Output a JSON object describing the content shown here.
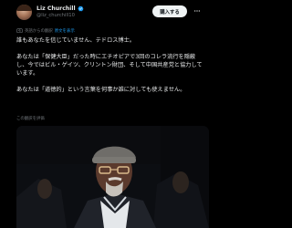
{
  "author": {
    "display_name": "Liz Churchill",
    "verified": true,
    "handle": "@liz_churchill10"
  },
  "header": {
    "follow_label": "購入する",
    "more_icon": "more-horizontal-icon"
  },
  "translation": {
    "prefix": "英語からの翻訳",
    "link": "原文を表示"
  },
  "post": {
    "paragraphs": [
      "誰もあなたを信じていません、テドロス博士。",
      "あなたは「保健大臣」だった時にエチオピアで3回のコレラ流行を隠蔽し、今ではビル・ゲイツ、クリントン財団、そして中国共産党と協力しています。",
      "あなたは「道徳的」という言葉を何事か誰に対しても使えません。"
    ],
    "translation_note": "この翻訳を評価",
    "rate_link": "翻訳を評価"
  },
  "media": {
    "alt": "photo",
    "colors": {
      "background": "#0d0f13",
      "cap": "#6f6d69",
      "face": "#5b3a2d",
      "jacket": "#20232a"
    }
  },
  "colors": {
    "background": "#000000",
    "text": "#e7e9ea",
    "secondary": "#71767b",
    "link": "#1d9bf0",
    "button": "#eff3f4"
  }
}
